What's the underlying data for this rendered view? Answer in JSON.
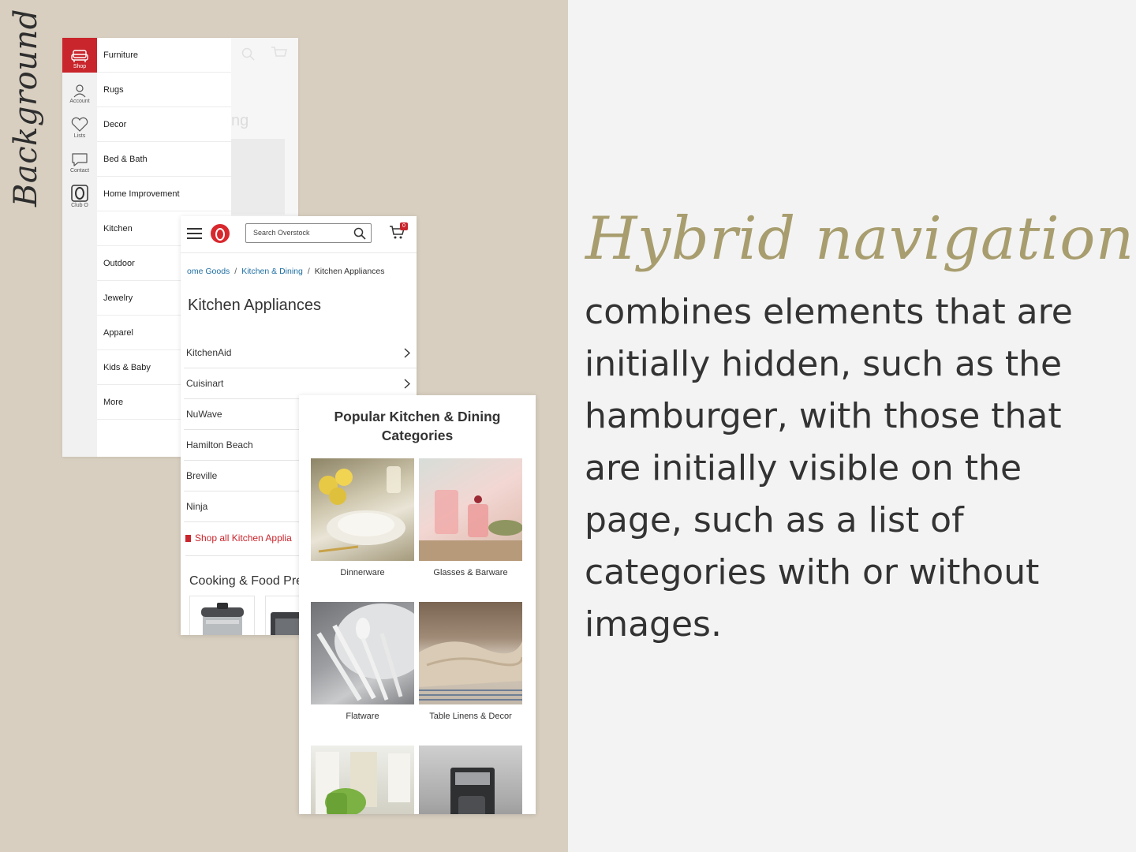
{
  "side_label": "Background",
  "menu": {
    "rail": [
      {
        "label": "Shop",
        "icon": "sofa-icon",
        "active": true
      },
      {
        "label": "Account",
        "icon": "user-icon"
      },
      {
        "label": "Lists",
        "icon": "heart-icon"
      },
      {
        "label": "Contact",
        "icon": "chat-icon"
      },
      {
        "label": "Club O",
        "icon": "club-o-icon"
      }
    ],
    "items": [
      "Furniture",
      "Rugs",
      "Decor",
      "Bed & Bath",
      "Home Improvement",
      "Kitchen",
      "Outdoor",
      "Jewelry",
      "Apparel",
      "Kids & Baby",
      "More"
    ],
    "ghost_text": "ng"
  },
  "kitchen": {
    "search_placeholder": "Search Overstock",
    "cart_count": "0",
    "breadcrumbs": [
      "ome Goods",
      "Kitchen & Dining",
      "Kitchen Appliances"
    ],
    "title": "Kitchen Appliances",
    "brands": [
      "KitchenAid",
      "Cuisinart",
      "NuWave",
      "Hamilton Beach",
      "Breville",
      "Ninja"
    ],
    "shop_all": "Shop all Kitchen Applia",
    "section": "Cooking & Food Pre"
  },
  "popular": {
    "title": "Popular Kitchen & Dining Categories",
    "tiles": [
      {
        "label": "Dinnerware"
      },
      {
        "label": "Glasses & Barware"
      },
      {
        "label": "Flatware"
      },
      {
        "label": "Table Linens & Decor"
      },
      {
        "label": ""
      },
      {
        "label": ""
      }
    ]
  },
  "heading": "Hybrid navigation",
  "body": "combines elements that are initially hidden, such as the hamburger, with those that are initially visible on the page, such as a list of categories with or without images.",
  "colors": {
    "accent_red": "#c9252c",
    "heading_gold": "#a89d6e",
    "left_bg": "#d8cfc0",
    "link_blue": "#1f6fa3"
  }
}
